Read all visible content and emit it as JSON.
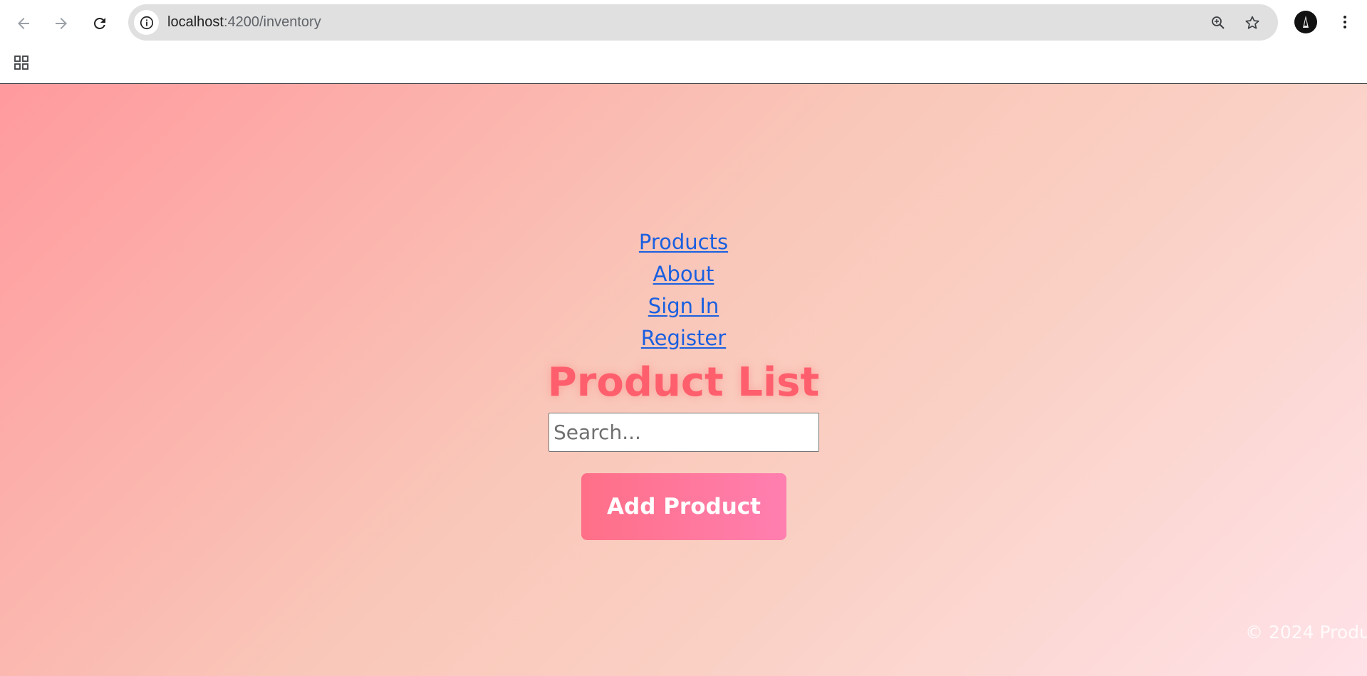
{
  "browser": {
    "url_host": "localhost",
    "url_path": ":4200/inventory",
    "icons": {
      "back": "arrow-left-icon",
      "forward": "arrow-right-icon",
      "reload": "reload-icon",
      "site_info": "info-icon",
      "zoom": "zoom-in-icon",
      "bookmark": "star-icon",
      "menu": "kebab-menu-icon",
      "apps": "apps-grid-icon"
    }
  },
  "nav": {
    "links": [
      {
        "label": "Products"
      },
      {
        "label": "About"
      },
      {
        "label": "Sign In"
      },
      {
        "label": "Register"
      }
    ]
  },
  "main": {
    "title": "Product List",
    "search_placeholder": "Search...",
    "add_button_label": "Add Product"
  },
  "footer": {
    "text": "© 2024 Produ"
  },
  "colors": {
    "title": "#ff5f6d",
    "link": "#1a5fe0",
    "button_start": "#ff6f87",
    "button_end": "#ff7fb0",
    "gradient_start": "#ff9a9e",
    "gradient_end": "#ffe2e8"
  }
}
